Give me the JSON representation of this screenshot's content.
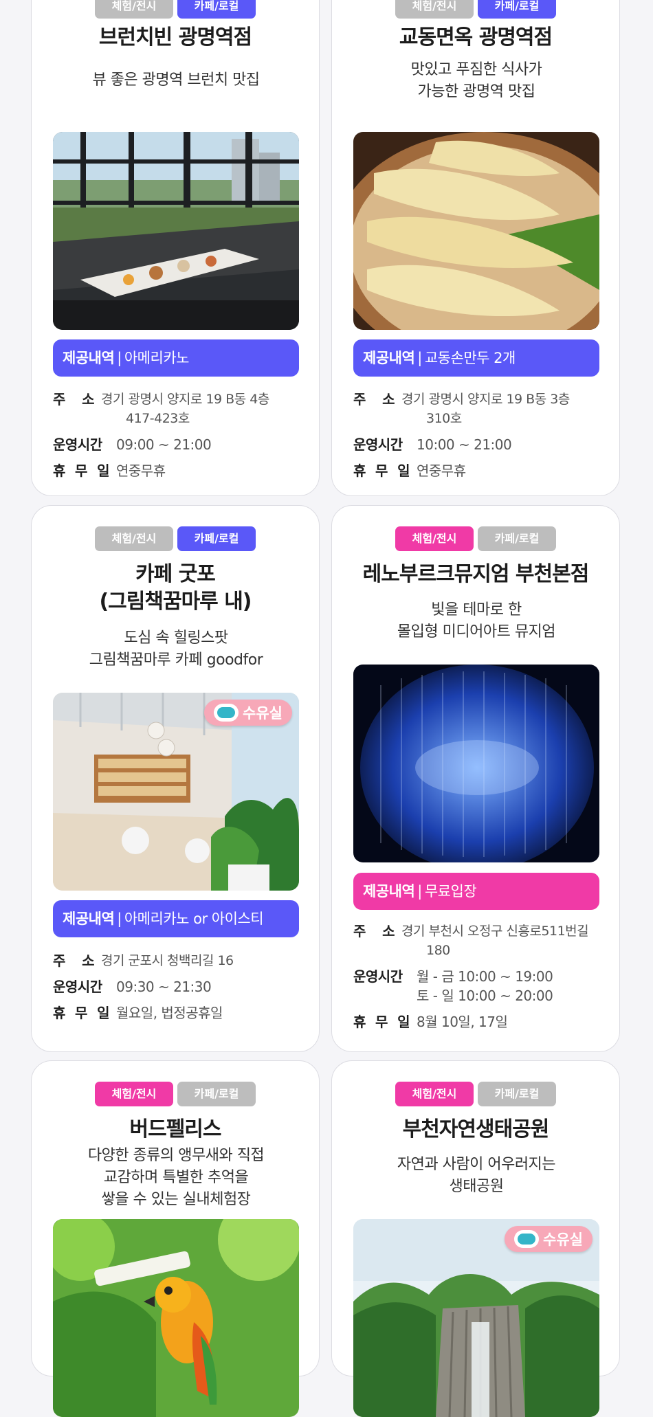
{
  "labels": {
    "provide": "제공내역",
    "address_1": "주",
    "address_2": "소",
    "hours": "운영시간",
    "closed_1": "휴",
    "closed_2": "무",
    "closed_3": "일",
    "nursing_room": "수유실"
  },
  "tags": {
    "experience": "체험/전시",
    "cafe": "카페/로컬"
  },
  "colors": {
    "blue": "#5a58f8",
    "pink": "#f03aa6",
    "gray": "#bdbdbd"
  },
  "cards": [
    {
      "name": "브런치빈 광명역점",
      "desc_lines": [
        "뷰 좋은 광명역 브런치 맛집"
      ],
      "provide": "아메리카노",
      "address_lines": [
        "경기 광명시 양지로 19 B동 4층",
        "417-423호"
      ],
      "hours_lines": [
        "09:00 ~ 21:00"
      ],
      "closed": "연중무휴",
      "photo_icon": "restaurant-window-photo"
    },
    {
      "name": "교동면옥 광명역점",
      "desc_lines": [
        "맛있고 푸짐한 식사가",
        "가능한 광명역 맛집"
      ],
      "provide": "교동손만두 2개",
      "address_lines": [
        "경기 광명시 양지로 19 B동 3층",
        "310호"
      ],
      "hours_lines": [
        "10:00 ~ 21:00"
      ],
      "closed": "연중무휴",
      "photo_icon": "dumplings-photo"
    },
    {
      "name_lines": [
        "카페 굿포",
        "(그림책꿈마루 내)"
      ],
      "desc_lines": [
        "도심 속 힐링스팟",
        "그림책꿈마루 카페 goodfor"
      ],
      "provide": "아메리카노 or 아이스티",
      "address_lines": [
        "경기 군포시 청백리길 16"
      ],
      "hours_lines": [
        "09:30 ~ 21:30"
      ],
      "closed": "월요일, 법정공휴일",
      "photo_icon": "cafe-interior-photo"
    },
    {
      "name": "레노부르크뮤지엄 부천본점",
      "desc_lines": [
        "빛을 테마로 한",
        "몰입형 미디어아트 뮤지엄"
      ],
      "provide": "무료입장",
      "address_lines": [
        "경기 부천시 오정구 신흥로511번길",
        "180"
      ],
      "hours_lines": [
        "월 - 금 10:00 ~ 19:00",
        "토 - 일 10:00 ~ 20:00"
      ],
      "closed": "8월 10일, 17일",
      "photo_icon": "media-art-photo"
    },
    {
      "name": "버드펠리스",
      "desc_lines": [
        "다양한 종류의 앵무새와 직접",
        "교감하며 특별한 추억을",
        "쌓을 수 있는 실내체험장"
      ],
      "photo_icon": "parrot-photo"
    },
    {
      "name": "부천자연생태공원",
      "desc_lines": [
        "자연과 사람이 어우러지는",
        "생태공원"
      ],
      "photo_icon": "eco-park-photo"
    }
  ]
}
